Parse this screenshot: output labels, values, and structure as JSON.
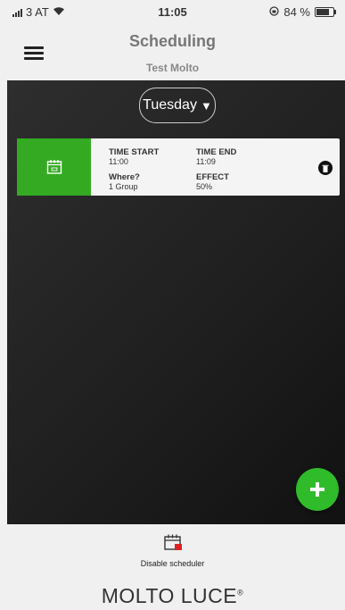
{
  "status_bar": {
    "carrier": "3 AT",
    "time": "11:05",
    "battery": "84 %",
    "battery_level": 0.84
  },
  "header": {
    "title": "Scheduling",
    "subtitle": "Test Molto",
    "menu_icon": "hamburger-menu-icon"
  },
  "day_selector": {
    "value": "Tuesday",
    "arrow": "▼"
  },
  "schedules": [
    {
      "time_start_label": "TIME START",
      "time_start": "11:00",
      "time_end_label": "TIME END",
      "time_end": "11:09",
      "where_label": "Where?",
      "where": "1 Group",
      "effect_label": "EFFECT",
      "effect": "50%",
      "accent": "#33aa22",
      "icon": "calendar-icon",
      "delete_icon": "trash-icon"
    }
  ],
  "fab": {
    "icon": "plus-icon",
    "color": "#2fbb2a"
  },
  "footer": {
    "disable_label": "Disable scheduler",
    "disable_icon": "calendar-disable-icon",
    "logo_text": "MOLTO LUCE",
    "logo_mark": "®"
  }
}
